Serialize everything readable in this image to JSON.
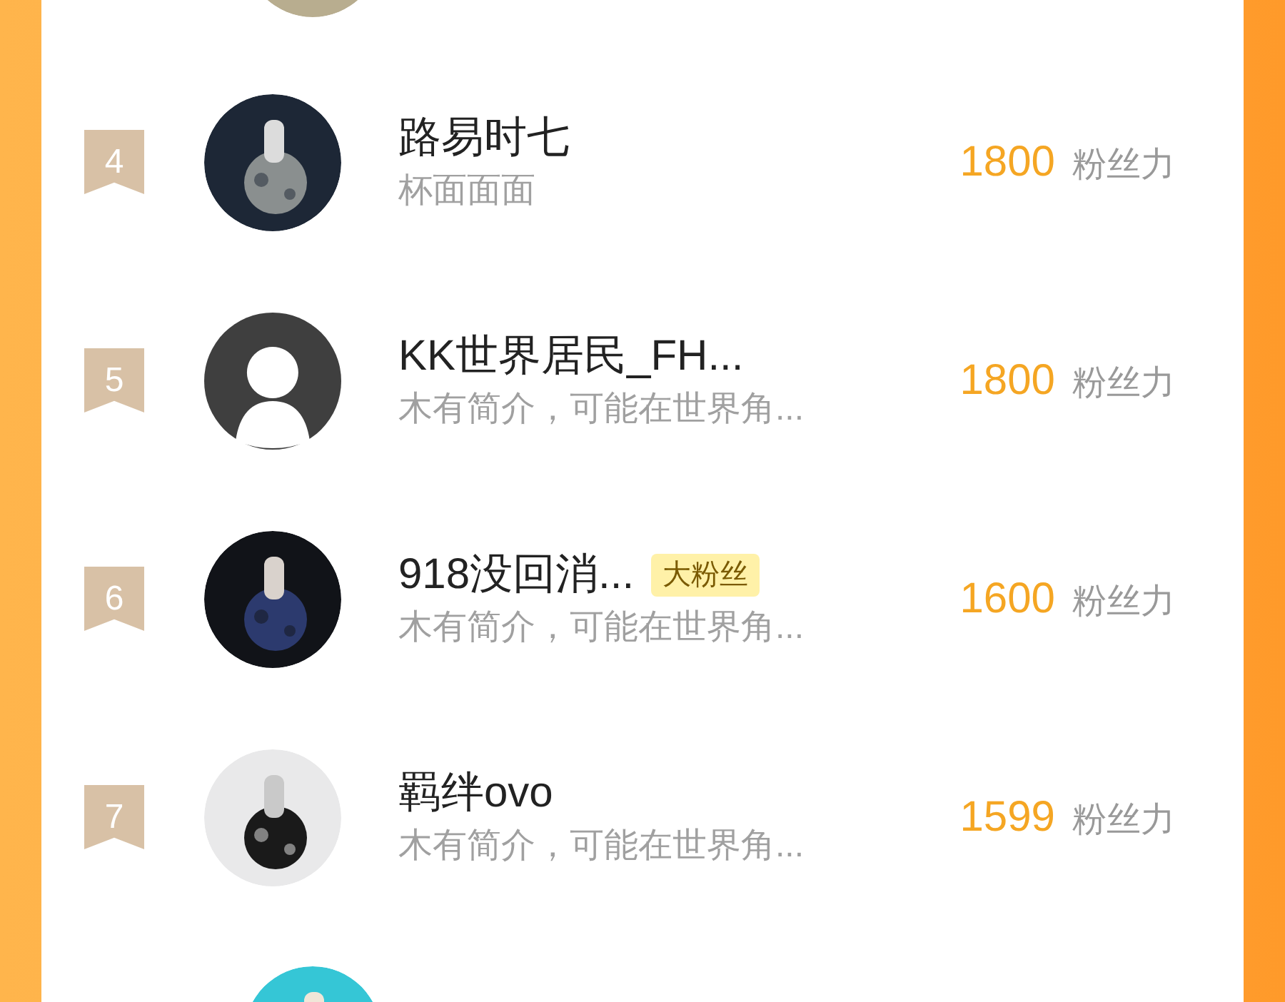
{
  "rows": [
    {
      "rank": "4",
      "name": "路易时七",
      "subtitle": "杯面面面",
      "score": "1800",
      "unit": "粉丝力"
    },
    {
      "rank": "5",
      "avatar": {
        "kind": "default"
      },
      "name": "KK世界居民_FH...",
      "subtitle": "木有简介，可能在世界角...",
      "score": "1800",
      "unit": "粉丝力"
    },
    {
      "rank": "6",
      "name": "918没回消...",
      "badge": "大粉丝",
      "subtitle": "木有简介，可能在世界角...",
      "score": "1600",
      "unit": "粉丝力"
    },
    {
      "rank": "7",
      "name": "羁绊ovo",
      "subtitle": "木有简介，可能在世界角...",
      "score": "1599",
      "unit": "粉丝力"
    }
  ]
}
